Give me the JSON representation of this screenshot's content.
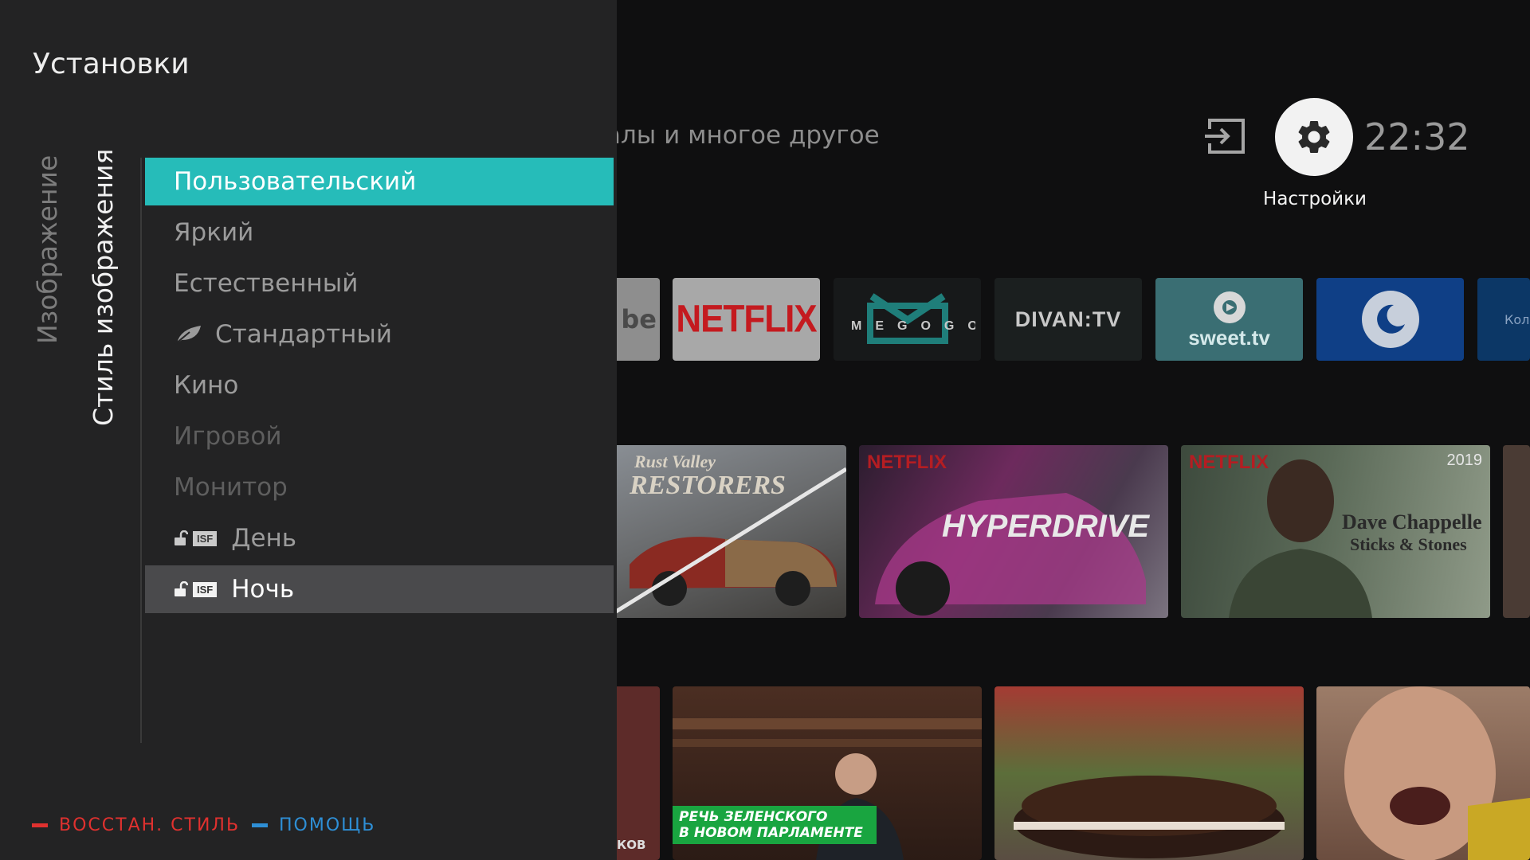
{
  "home": {
    "subtitle": "алы и многое другое",
    "settings_label": "Настройки",
    "clock": "22:32",
    "apps": {
      "youtube": "be",
      "netflix": "NETFLIX",
      "megogo": "MEGOGO",
      "divan": "DIVAN:TV",
      "sweet": "sweet.tv",
      "partial": "Кол"
    },
    "row2": {
      "rust_title_1": "Rust Valley",
      "rust_title_2": "RESTORERS",
      "hyper_brand": "NETFLIX",
      "hyper_title": "HYPERDRIVE",
      "dave_brand": "NETFLIX",
      "dave_year": "2019",
      "dave_title_1": "Dave Chappelle",
      "dave_title_2": "Sticks & Stones"
    },
    "row3": {
      "partial_text": "КОВ",
      "banner_1": "РЕЧЬ ЗЕЛЕНСКОГО",
      "banner_2": "В НОВОМ ПАРЛАМЕНТЕ"
    }
  },
  "panel": {
    "title": "Установки",
    "tabs": {
      "image": "Изображение",
      "style": "Стиль изображения"
    },
    "menu": [
      {
        "label": "Пользовательский",
        "state": "selected"
      },
      {
        "label": "Яркий",
        "state": "normal"
      },
      {
        "label": "Естественный",
        "state": "normal"
      },
      {
        "label": "Стандартный",
        "state": "normal",
        "icon": "leaf-icon"
      },
      {
        "label": "Кино",
        "state": "normal"
      },
      {
        "label": "Игровой",
        "state": "dim"
      },
      {
        "label": "Монитор",
        "state": "dim"
      },
      {
        "label": "День",
        "state": "normal",
        "icon": "lock-icon",
        "badge": "ISF"
      },
      {
        "label": "Ночь",
        "state": "focused",
        "icon": "lock-icon",
        "badge": "ISF"
      }
    ],
    "footer": {
      "red_label": "ВОССТАН. СТИЛЬ",
      "blue_label": "ПОМОЩЬ"
    }
  },
  "colors": {
    "accent_selected": "#26bcb9",
    "panel_bg": "#232324",
    "footer_red": "#e0312f",
    "footer_blue": "#2e8fd6"
  }
}
